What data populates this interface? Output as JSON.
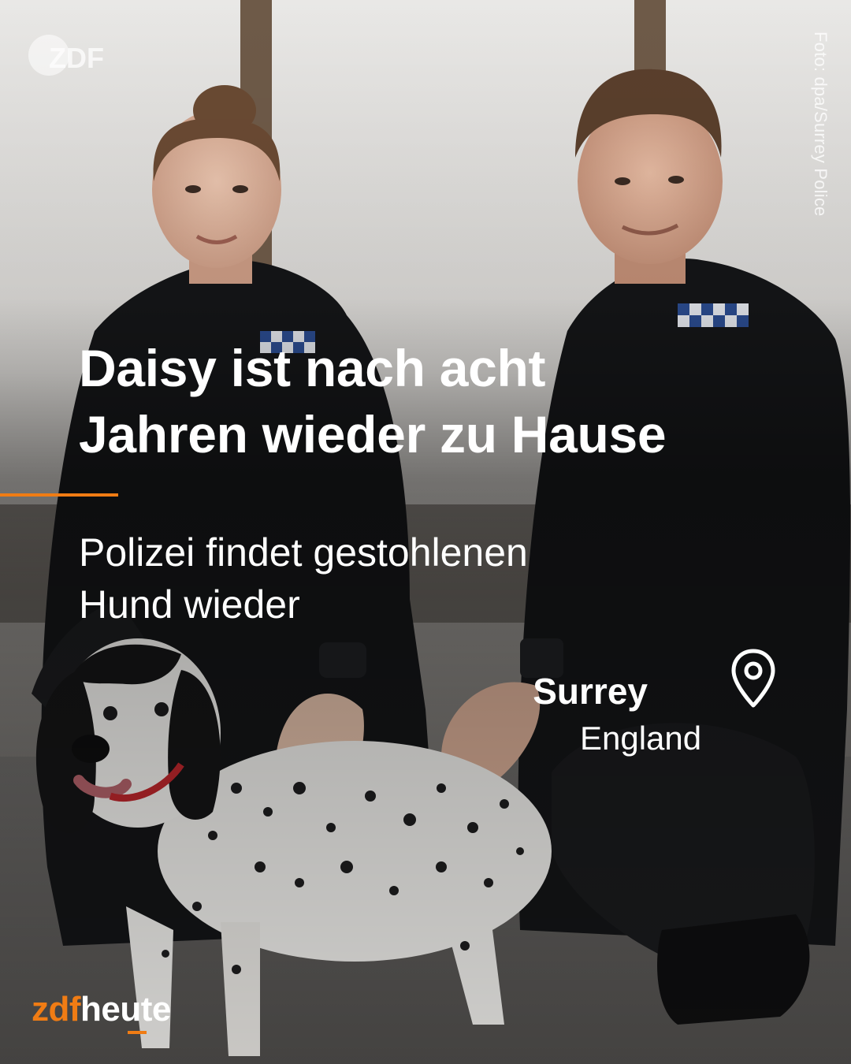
{
  "watermark": {
    "logo_text": "ZDF"
  },
  "photo_credit": "Foto: dpa/Surrey Police",
  "headline": {
    "line1": "Daisy ist nach acht",
    "line2": "Jahren wieder zu Hause"
  },
  "subline": {
    "line1": "Polizei findet gestohlenen",
    "line2": "Hund wieder"
  },
  "location": {
    "region": "Surrey",
    "country": "England",
    "icon": "map-pin-icon"
  },
  "brand": {
    "part1": "zdf",
    "part2": "heute"
  },
  "colors": {
    "accent": "#f07c14",
    "text": "#ffffff"
  }
}
